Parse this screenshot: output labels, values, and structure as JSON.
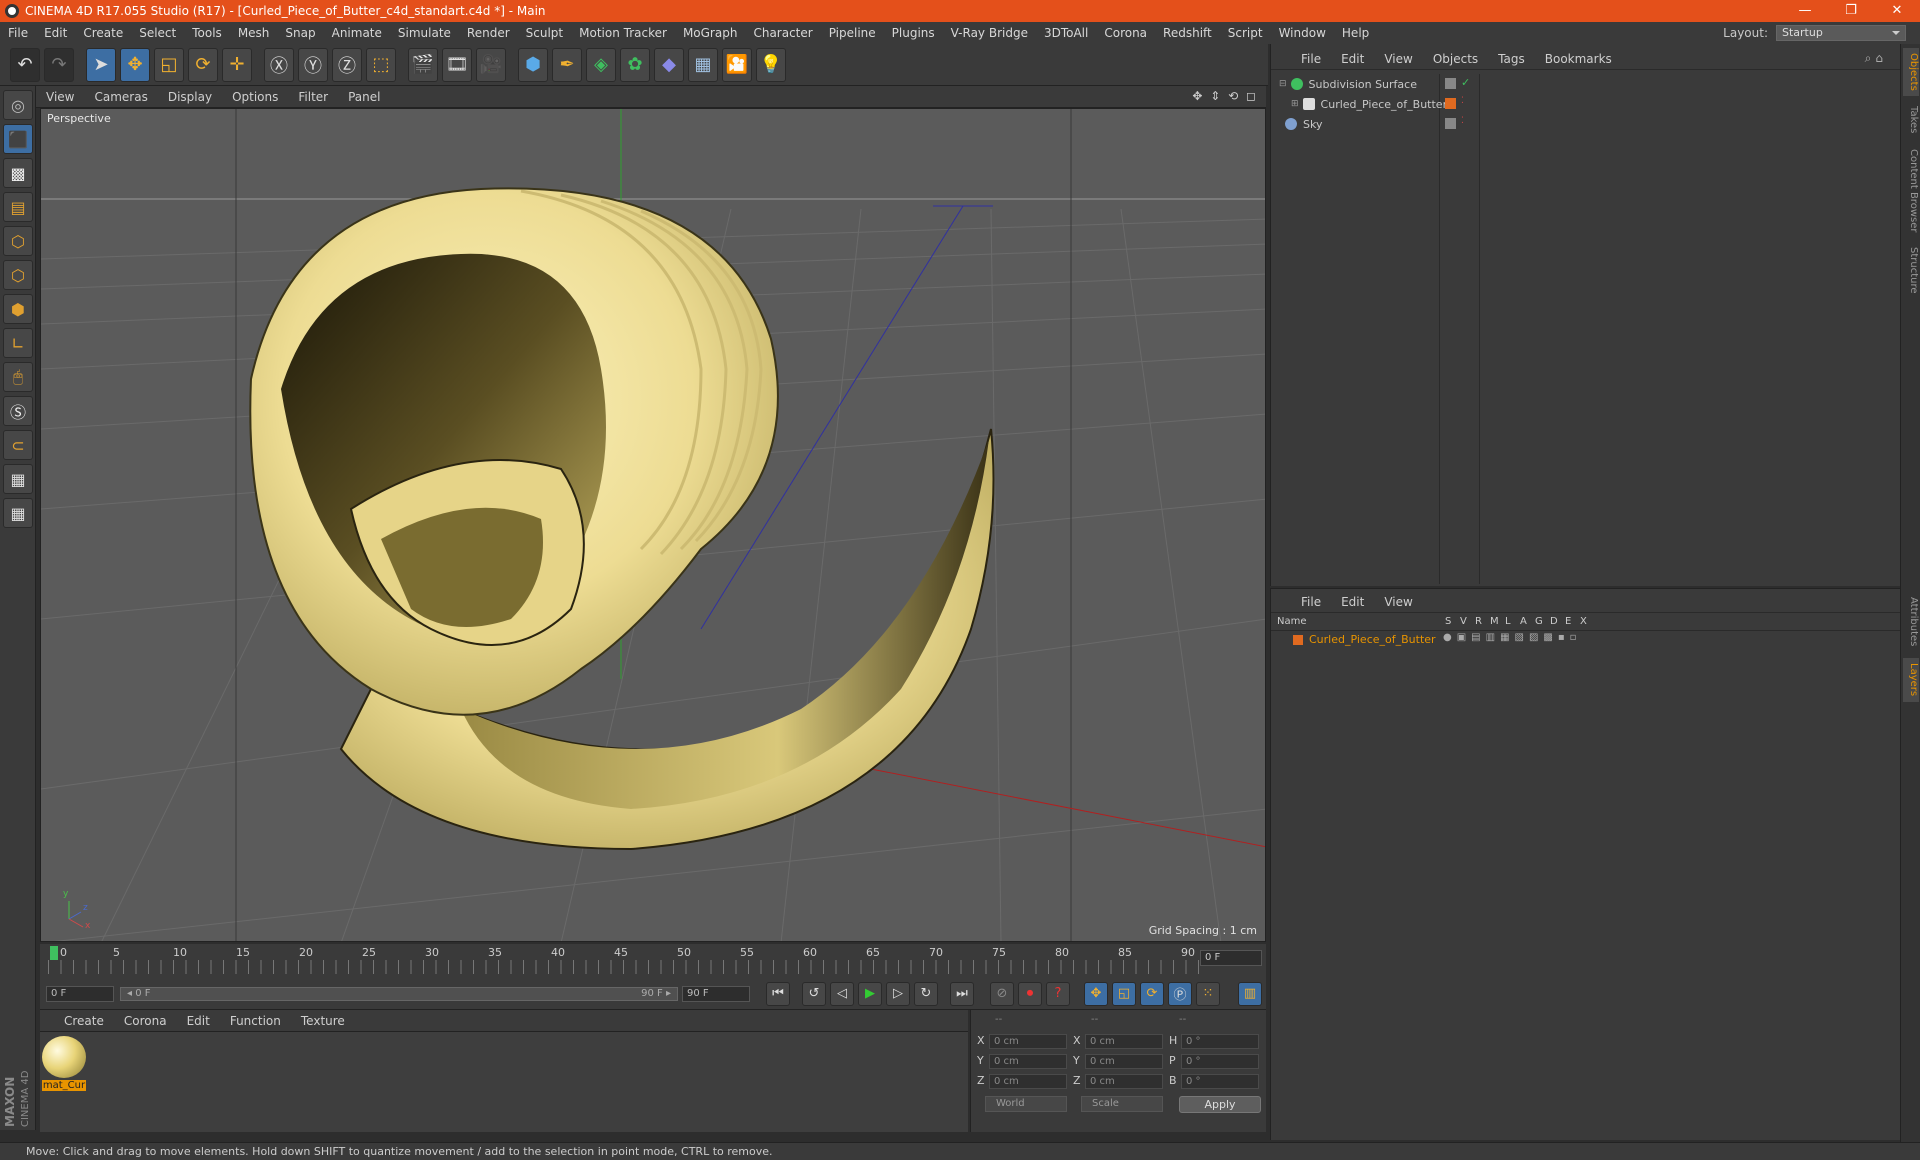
{
  "title_bar": {
    "title": "CINEMA 4D R17.055 Studio (R17) - [Curled_Piece_of_Butter_c4d_standart.c4d *] - Main",
    "minimize": "—",
    "restore": "❐",
    "close": "✕"
  },
  "menu": {
    "items": [
      "File",
      "Edit",
      "Create",
      "Select",
      "Tools",
      "Mesh",
      "Snap",
      "Animate",
      "Simulate",
      "Render",
      "Sculpt",
      "Motion Tracker",
      "MoGraph",
      "Character",
      "Pipeline",
      "Plugins",
      "V-Ray Bridge",
      "3DToAll",
      "Corona",
      "Redshift",
      "Script",
      "Window",
      "Help"
    ],
    "layout_label": "Layout:",
    "layout_value": "Startup"
  },
  "viewport": {
    "menu": [
      "View",
      "Cameras",
      "Display",
      "Options",
      "Filter",
      "Panel"
    ],
    "nav_icons": "✥ ⇕ ⟲ ◻",
    "label": "Perspective",
    "grid_spacing": "Grid Spacing : 1 cm",
    "axis_y": "y",
    "axis_z": "z",
    "axis_x": "x"
  },
  "timeline": {
    "ticks": [
      "0",
      "5",
      "10",
      "15",
      "20",
      "25",
      "30",
      "35",
      "40",
      "45",
      "50",
      "55",
      "60",
      "65",
      "70",
      "75",
      "80",
      "85",
      "90"
    ],
    "current_frame": "0 F",
    "start_field": "0 F",
    "slider_start": "◂ 0 F",
    "slider_end": "90 F ▸",
    "end_field": "90 F"
  },
  "material_manager": {
    "menu": [
      "Create",
      "Corona",
      "Edit",
      "Function",
      "Texture"
    ],
    "material_name": "mat_Cur"
  },
  "coordinates": {
    "headers": [
      "--",
      "--",
      "--"
    ],
    "rows": [
      {
        "l1": "X",
        "v1": "0 cm",
        "l2": "X",
        "v2": "0 cm",
        "l3": "H",
        "v3": "0 °"
      },
      {
        "l1": "Y",
        "v1": "0 cm",
        "l2": "Y",
        "v2": "0 cm",
        "l3": "P",
        "v3": "0 °"
      },
      {
        "l1": "Z",
        "v1": "0 cm",
        "l2": "Z",
        "v2": "0 cm",
        "l3": "B",
        "v3": "0 °"
      }
    ],
    "mode": "World",
    "scale": "Scale",
    "apply": "Apply"
  },
  "object_manager": {
    "menu": [
      "File",
      "Edit",
      "View",
      "Objects",
      "Tags",
      "Bookmarks"
    ],
    "objects": [
      {
        "name": "Subdivision Surface",
        "color": "#3fbf5f"
      },
      {
        "name": "Curled_Piece_of_Butter",
        "color": "#e0e0e0"
      },
      {
        "name": "Sky",
        "color": "#7fa0d0"
      }
    ]
  },
  "layer_manager": {
    "menu": [
      "File",
      "Edit",
      "View"
    ],
    "col_name": "Name",
    "cols": [
      "S",
      "V",
      "R",
      "M",
      "L",
      "A",
      "G",
      "D",
      "E",
      "X"
    ],
    "layer_name": "Curled_Piece_of_Butter"
  },
  "right_tabs": [
    "Objects",
    "Takes",
    "Content Browser",
    "Structure",
    "Attributes",
    "Layers"
  ],
  "branding": {
    "maxon": "MAXON",
    "product": "CINEMA 4D"
  },
  "status": "Move: Click and drag to move elements. Hold down SHIFT to quantize movement / add to the selection in point mode, CTRL to remove.",
  "colors": {
    "accent": "#e4501b",
    "selection": "#e89400",
    "butter": "#f2e4a0"
  }
}
